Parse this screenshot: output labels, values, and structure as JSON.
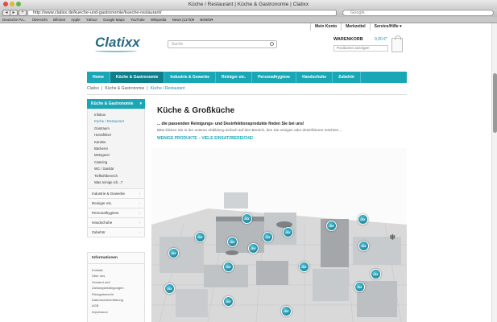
{
  "browser": {
    "title": "Küche / Restaurant | Küche & Gastronomie | Clatixx",
    "url": "http://www.clatixx.de/kueche-und-gastronomie/kueche-restaurant/",
    "search_placeholder": "Google",
    "bookmarks": [
      "Deutsche Pa...",
      "Übersicht",
      "Bifoinet",
      "Apple",
      "Yahoo!",
      "Google Maps",
      "YouTube",
      "Wikipedia",
      "News (1176)▾",
      "Beliebt▾"
    ]
  },
  "topbar": {
    "items": [
      "Mein Konto",
      "Merkzettel",
      "Service/Hilfe ▾"
    ]
  },
  "logo": {
    "text": "Clatixx"
  },
  "search": {
    "placeholder": "Suche"
  },
  "cart": {
    "title": "WARENKORB",
    "price": "0,00 €*",
    "select": "Positionen anzeigen"
  },
  "nav": {
    "items": [
      "Home",
      "Küche & Gastronomie",
      "Industrie & Gewerbe",
      "Reiniger etc.",
      "Personalhygiene",
      "Handschuhe",
      "Zubehör"
    ],
    "active_index": 1
  },
  "breadcrumb": [
    "Clatixx",
    "Küche & Gastronomie",
    "Küche / Restaurant"
  ],
  "sidebar": {
    "head": "Küche & Gastronomie",
    "sub": [
      "Infobox",
      "Küche / Restaurant",
      "Gastraum",
      "Heissfilmer",
      "Kantine",
      "Bäckerei",
      "Metzgerei",
      "Catering",
      "WC / Sanitär",
      "Tiefkühlbereich",
      "Was reinige ich...?"
    ],
    "categories": [
      "Industrie & Gewerbe",
      "Reiniger etc.",
      "Personalhygiene",
      "Handschuhe",
      "Zubehör"
    ]
  },
  "info": {
    "head": "Informationen",
    "items": [
      "Kontakt",
      "Über uns",
      "Versand und Zahlungsbedingungen",
      "Rückgaberecht",
      "Datenschutzerklärung",
      "AGB",
      "Impressum"
    ]
  },
  "main": {
    "title": "Küche & Großküche",
    "intro": "... die passenden Reinigungs- und Desinfektionsprodukte finden Sie bei uns!",
    "hint": "Bitte klicken Sie in der unteren Abbildung einfach auf den Bereich, den Sie reinigen oder desinfizieren möchten....",
    "link": "WENIGE PRODUKTE – VIELE EINSATZBEREICHE!"
  },
  "hotspots": {
    "label": "ixx",
    "count": 17
  },
  "colors": {
    "accent": "#1aa7b5",
    "accent_dark": "#0f7f8c",
    "link": "#1a8fb0"
  }
}
